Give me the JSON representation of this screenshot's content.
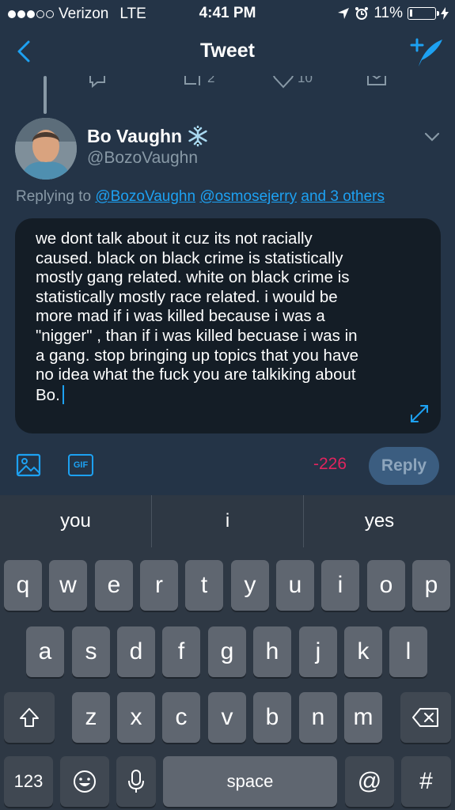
{
  "status_bar": {
    "carrier": "Verizon",
    "network": "LTE",
    "time": "4:41 PM",
    "battery": "11%",
    "battery_level": 0.11
  },
  "nav": {
    "title": "Tweet"
  },
  "previous_tweet_actions": {
    "retweets": "2",
    "likes": "10"
  },
  "author": {
    "name": "Bo Vaughn",
    "handle": "@BozoVaughn"
  },
  "replying": {
    "prefix": "Replying to",
    "mention1": "@BozoVaughn",
    "mention2": "@osmosejerry",
    "others": "and 3 others"
  },
  "composer": {
    "text_lines": [
      "we dont talk about it cuz its not racially",
      "caused. black on black crime is statistically",
      "mostly gang related. white on black crime is",
      "statistically mostly race related. i would be",
      "more mad if i was killed because i was a",
      "\"nigger\" , than if i was killed becuase i was in",
      "a gang. stop bringing up topics that you have",
      "no idea what the fuck you are talkiking about",
      "Bo."
    ]
  },
  "toolbar": {
    "gif_label": "GIF",
    "char_count": "-226",
    "reply_label": "Reply"
  },
  "keyboard": {
    "suggestions": [
      "you",
      "i",
      "yes"
    ],
    "row1": [
      "q",
      "w",
      "e",
      "r",
      "t",
      "y",
      "u",
      "i",
      "o",
      "p"
    ],
    "row2": [
      "a",
      "s",
      "d",
      "f",
      "g",
      "h",
      "j",
      "k",
      "l"
    ],
    "row3": [
      "z",
      "x",
      "c",
      "v",
      "b",
      "n",
      "m"
    ],
    "numbers_label": "123",
    "space_label": "space",
    "at_label": "@",
    "hash_label": "#"
  },
  "colors": {
    "background": "#243447",
    "accent": "#1da1f2",
    "negative_count": "#e0245e"
  }
}
